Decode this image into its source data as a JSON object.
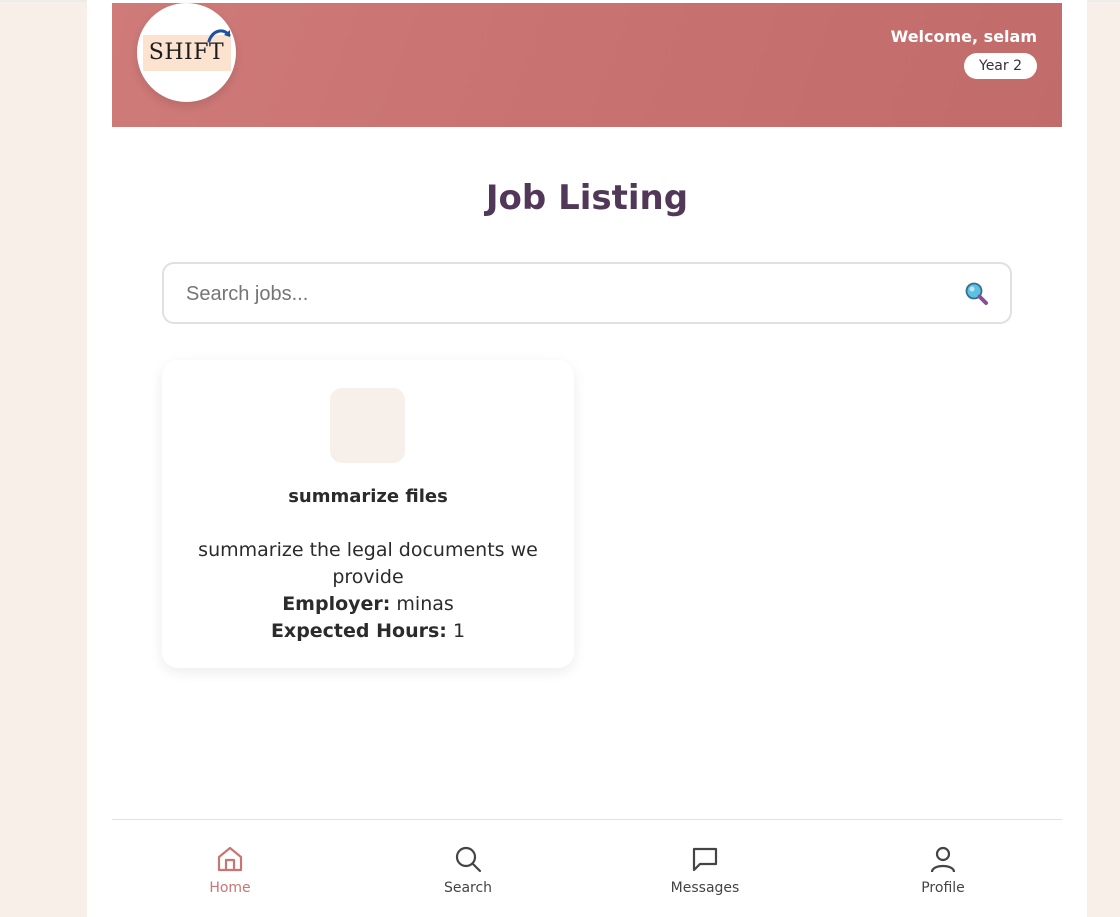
{
  "header": {
    "logo_text": "SHIFT",
    "welcome_text": "Welcome, selam",
    "year_badge": "Year 2"
  },
  "page_title": "Job Listing",
  "search": {
    "placeholder": "Search jobs...",
    "value": "",
    "icon": "magnifier-icon"
  },
  "jobs": [
    {
      "title": "summarize files",
      "description": "summarize the legal documents we provide",
      "employer_label": "Employer:",
      "employer": "minas",
      "hours_label": "Expected Hours:",
      "hours": "1"
    }
  ],
  "nav": {
    "items": [
      {
        "label": "Home",
        "icon": "home-icon",
        "active": true
      },
      {
        "label": "Search",
        "icon": "search-icon",
        "active": false
      },
      {
        "label": "Messages",
        "icon": "message-icon",
        "active": false
      },
      {
        "label": "Profile",
        "icon": "user-icon",
        "active": false
      }
    ]
  },
  "colors": {
    "header": "#c97573",
    "title": "#523858",
    "active_nav": "#c97573",
    "background": "#f8efe9"
  }
}
